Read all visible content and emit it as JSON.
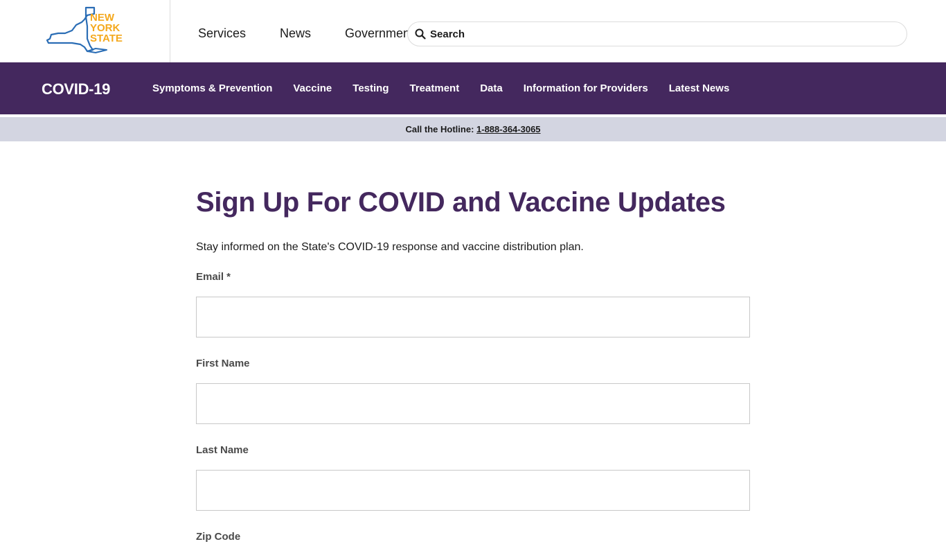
{
  "header": {
    "logo_lines": [
      "NEW",
      "YORK",
      "STATE"
    ],
    "global_nav": [
      {
        "label": "Services"
      },
      {
        "label": "News"
      },
      {
        "label": "Government"
      }
    ],
    "search": {
      "placeholder": "Search",
      "value": ""
    }
  },
  "covid_nav": {
    "title": "COVID-19",
    "items": [
      {
        "label": "Symptoms & Prevention"
      },
      {
        "label": "Vaccine"
      },
      {
        "label": "Testing"
      },
      {
        "label": "Treatment"
      },
      {
        "label": "Data"
      },
      {
        "label": "Information for Providers"
      },
      {
        "label": "Latest News"
      }
    ],
    "colors": {
      "bar": "#44285e",
      "hotline_bg": "#d3d5e1"
    }
  },
  "hotline": {
    "prefix": "Call the Hotline: ",
    "phone": "1-888-364-3065"
  },
  "main": {
    "title": "Sign Up For COVID and Vaccine Updates",
    "intro": "Stay informed on the State's COVID-19 response and vaccine distribution plan.",
    "fields": [
      {
        "label": "Email *",
        "value": ""
      },
      {
        "label": "First Name",
        "value": ""
      },
      {
        "label": "Last Name",
        "value": ""
      },
      {
        "label": "Zip Code"
      }
    ]
  }
}
